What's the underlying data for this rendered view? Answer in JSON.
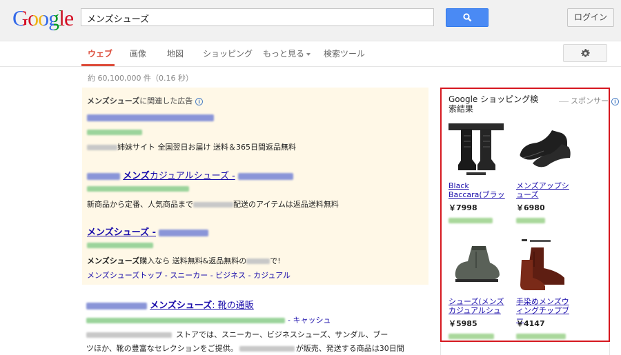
{
  "header": {
    "logo": "Google",
    "search_query": "メンズシューズ",
    "login_label": "ログイン"
  },
  "nav": {
    "tabs": [
      "ウェブ",
      "画像",
      "地図",
      "ショッピング",
      "もっと見る",
      "検索ツール"
    ]
  },
  "stats": "約 60,100,000 件（0.16 秒）",
  "ads": {
    "header_query": "メンズシューズ",
    "header_suffix": "に関連した広告",
    "ad1": {
      "desc": "姉妹サイト 全国翌日お届け 送料＆365日間返品無料"
    },
    "ad2": {
      "title_bold": "メンズ",
      "title_rest": "カジュアルシューズ -",
      "desc_prefix": "新商品から定番、人気商品まで",
      "desc_suffix": "配送のアイテムは返品送料無料"
    },
    "ad3": {
      "title": "メンズシューズ -",
      "desc_bold": "メンズシューズ",
      "desc_mid": "購入なら 送料無料&返品無料の",
      "desc_suffix": "で!",
      "sitelinks": "メンズシューズトップ - スニーカー - ビジネス - カジュアル"
    }
  },
  "organic": {
    "title_bold": "メンズシューズ",
    "title_rest": ": 靴の通販",
    "url_suffix": "- キャッシュ",
    "desc1": "ストアでは、スニーカー、ビジネスシューズ、サンダル、ブー",
    "desc2_prefix": "ツほか、靴の豊富なセレクションをご提供。",
    "desc2_suffix": "が販売、発送する商品は30日間"
  },
  "shopping": {
    "title": "Google ショッピング検索結果",
    "sponsor": "スポンサー",
    "products": [
      {
        "name": "Black Baccara(ブラッ",
        "price": "￥7998"
      },
      {
        "name": "メンズアップシューズ",
        "price": "￥6980"
      },
      {
        "name": "シューズ(メンズカジュアルシュ",
        "price": "￥5985"
      },
      {
        "name": "手染めメンズウィングチップブー",
        "price": "￥4147"
      }
    ]
  },
  "colors": {
    "accent": "#dd4b39",
    "link": "#1a0dab",
    "url": "#009933",
    "ad_bg": "#fff8e7",
    "highlight": "#d6171f"
  }
}
